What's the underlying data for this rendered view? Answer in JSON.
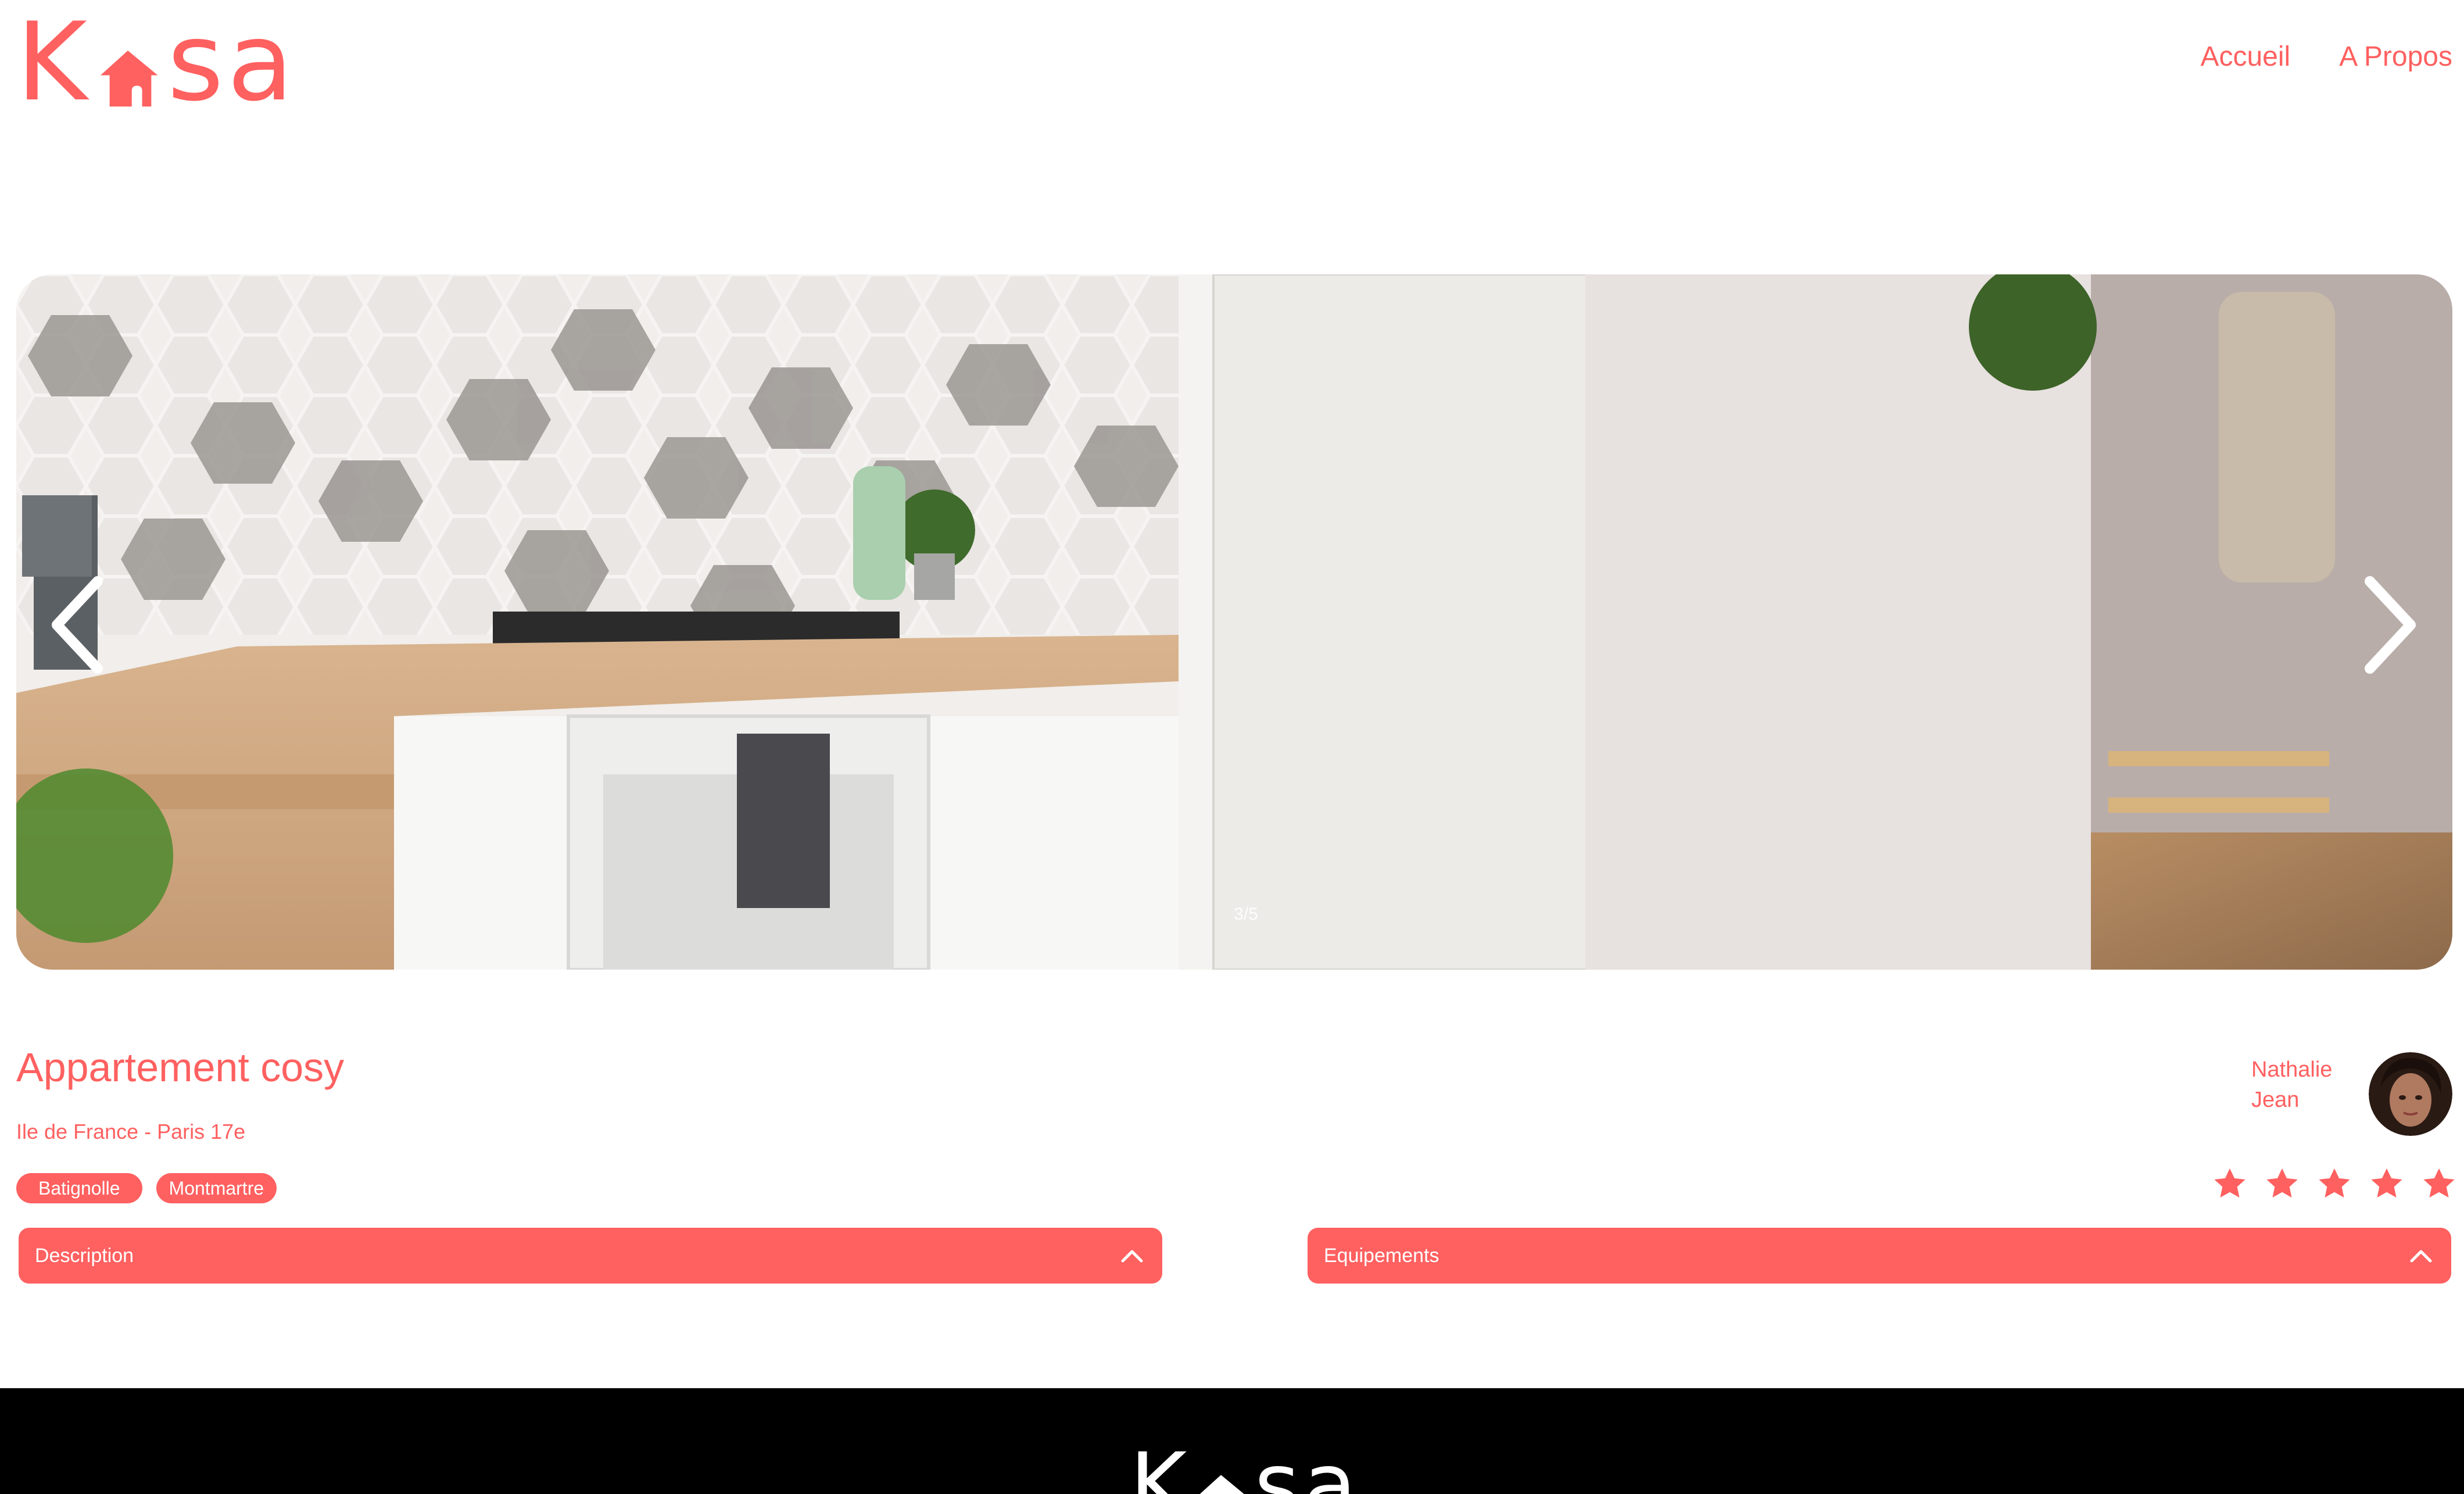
{
  "colors": {
    "accent": "#FF6060",
    "footer_bg": "#000000",
    "text_on_accent": "#FFFFFF"
  },
  "header": {
    "logo": {
      "letter_k": "K",
      "letters_sa": "sa",
      "icon": "house-icon"
    },
    "nav": [
      {
        "label": "Accueil"
      },
      {
        "label": "A Propos"
      }
    ]
  },
  "carousel": {
    "counter": "3/5",
    "prev_icon": "chevron-left-icon",
    "next_icon": "chevron-right-icon"
  },
  "listing": {
    "title": "Appartement cosy",
    "location": "Ile de France - Paris 17e",
    "tags": [
      "Batignolle",
      "Montmartre"
    ],
    "host": {
      "first_name": "Nathalie",
      "last_name": "Jean"
    },
    "rating": {
      "value": 5,
      "max": 5,
      "icon": "star-icon"
    }
  },
  "collapses": [
    {
      "label": "Description",
      "icon": "chevron-up-icon"
    },
    {
      "label": "Equipements",
      "icon": "chevron-up-icon"
    }
  ],
  "footer": {
    "logo": {
      "letter_k": "K",
      "letters_sa": "sa",
      "icon": "house-icon"
    }
  }
}
